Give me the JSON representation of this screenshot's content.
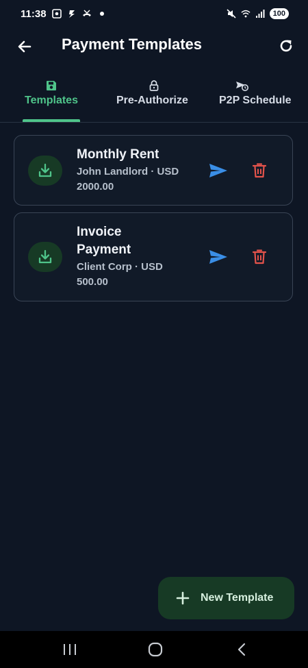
{
  "status_bar": {
    "time": "11:38",
    "battery": "100",
    "left_icons": [
      "screen-record-icon",
      "shazam-icon",
      "phone-missed-icon",
      "dot-icon"
    ],
    "right_icons": [
      "mute-icon",
      "wifi-icon",
      "signal-icon"
    ]
  },
  "header": {
    "title": "Payment Templates",
    "back_icon": "arrow-left-icon",
    "refresh_icon": "refresh-icon"
  },
  "tabs": [
    {
      "label": "Templates",
      "icon": "save-icon",
      "active": true
    },
    {
      "label": "Pre-Authorize",
      "icon": "lock-icon",
      "active": false
    },
    {
      "label": "P2P Schedule",
      "icon": "scheduled-transfer-icon",
      "active": false
    }
  ],
  "templates": [
    {
      "title": "Monthly Rent",
      "subtitle": "John Landlord · USD 2000.00",
      "icon": "download-icon"
    },
    {
      "title": "Invoice Payment",
      "subtitle": "Client Corp · USD 500.00",
      "icon": "download-icon"
    }
  ],
  "fab": {
    "label": "New Template",
    "icon": "plus-icon"
  },
  "colors": {
    "background": "#0e1624",
    "accent": "#4fc48a",
    "send": "#3a8ee6",
    "delete": "#e5534b",
    "fab_bg": "#173a25"
  }
}
